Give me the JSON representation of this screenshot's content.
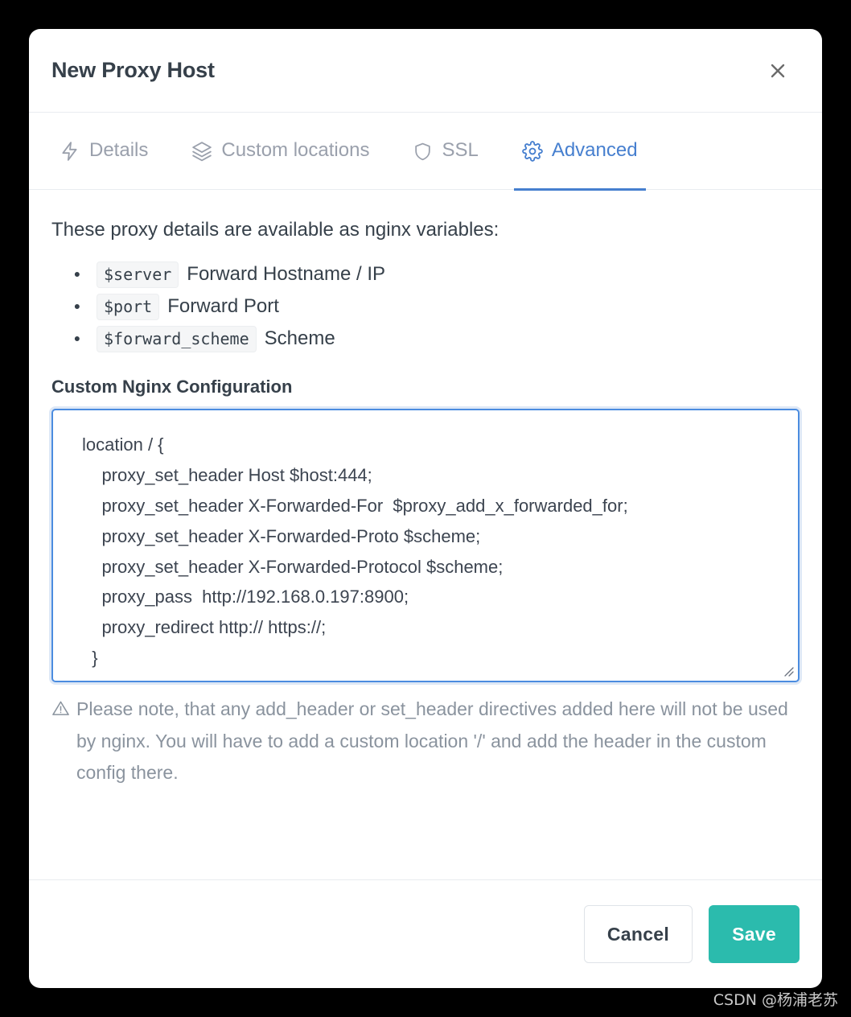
{
  "modal": {
    "title": "New Proxy Host",
    "close_icon": "close-icon"
  },
  "tabs": [
    {
      "label": "Details",
      "icon": "lightning-bolt-icon",
      "active": false
    },
    {
      "label": "Custom locations",
      "icon": "layers-icon",
      "active": false
    },
    {
      "label": "SSL",
      "icon": "shield-icon",
      "active": false
    },
    {
      "label": "Advanced",
      "icon": "gear-icon",
      "active": true
    }
  ],
  "content": {
    "intro": "These proxy details are available as nginx variables:",
    "variables": [
      {
        "name": "$server",
        "desc": "Forward Hostname / IP"
      },
      {
        "name": "$port",
        "desc": "Forward Port"
      },
      {
        "name": "$forward_scheme",
        "desc": "Scheme"
      }
    ],
    "config_label": "Custom Nginx Configuration",
    "config_value": "location / {\n    proxy_set_header Host $host:444;\n    proxy_set_header X-Forwarded-For  $proxy_add_x_forwarded_for;\n    proxy_set_header X-Forwarded-Proto $scheme;\n    proxy_set_header X-Forwarded-Protocol $scheme;\n    proxy_pass  http://192.168.0.197:8900;\n    proxy_redirect http:// https://;\n  }",
    "config_placeholder": "",
    "note": "Please note, that any add_header or set_header directives added here will not be used by nginx. You will have to add a custom location '/' and add the header in the custom config there.",
    "note_icon": "warning-triangle-icon"
  },
  "footer": {
    "cancel_label": "Cancel",
    "save_label": "Save"
  },
  "watermark": "CSDN @杨浦老苏",
  "colors": {
    "accent_blue": "#467fcf",
    "save_teal": "#2bbbad",
    "text_dark": "#36404a",
    "text_muted": "#9aa0ac",
    "page_background": "#000000"
  }
}
